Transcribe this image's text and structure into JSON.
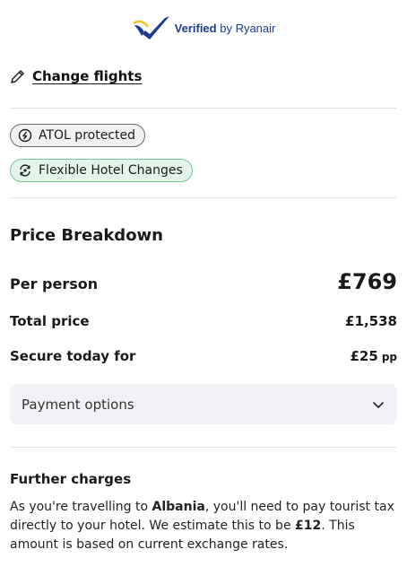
{
  "verified": {
    "verified_word": "Verified",
    "by_text": " by Ryanair",
    "logo_icon": "ryanair-harp-checkmark"
  },
  "change_flights": {
    "label": "Change flights",
    "icon": "pencil-icon"
  },
  "badges": [
    {
      "label": "ATOL protected",
      "icon": "atol-icon"
    },
    {
      "label": "Flexible Hotel Changes",
      "icon": "flexible-icon"
    }
  ],
  "price_breakdown": {
    "heading": "Price Breakdown",
    "per_person_label": "Per person",
    "per_person_value": "£769",
    "total_label": "Total price",
    "total_value": "£1,538",
    "secure_label": "Secure today for",
    "secure_value": "£25",
    "secure_unit": "pp"
  },
  "payment_options": {
    "label": "Payment options",
    "icon": "chevron-down-icon"
  },
  "further_charges": {
    "heading": "Further charges",
    "text_1": "As you're travelling to ",
    "destination": "Albania",
    "text_2": ", you'll need to pay tourist tax directly to your hotel. We estimate this to be ",
    "amount": "£12",
    "text_3": ". This amount is based on current exchange rates."
  },
  "colors": {
    "brand_blue": "#1f3a93",
    "flex_badge_bg": "#e3f5ea",
    "flex_badge_border": "#7cc59a",
    "atol_badge_bg": "#f1f1f3",
    "payment_bg": "#f2f2f6"
  }
}
